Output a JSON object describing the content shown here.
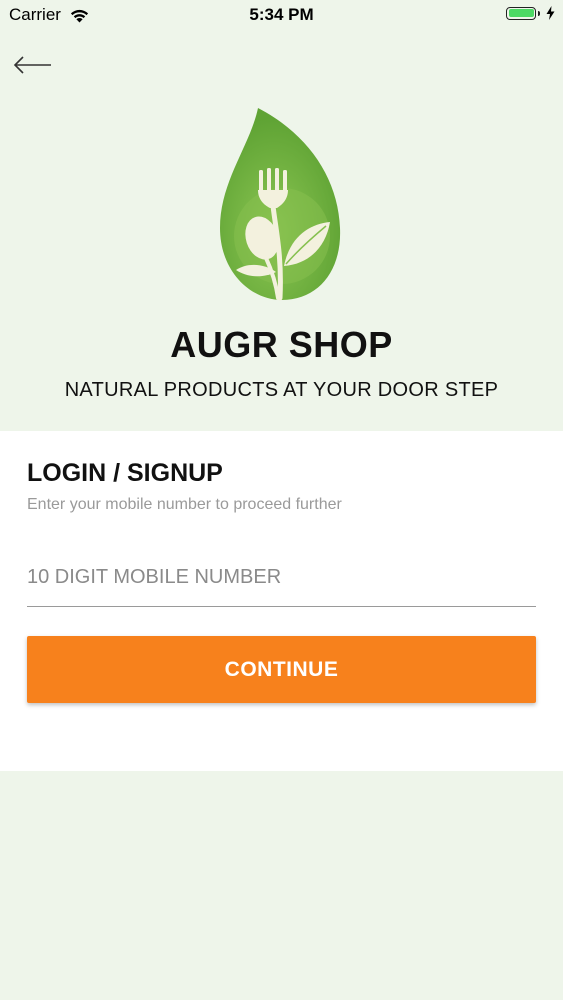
{
  "status_bar": {
    "carrier": "Carrier",
    "time": "5:34 PM",
    "battery_level": 1.0
  },
  "header": {
    "back_icon": "arrow-left-icon",
    "logo_icon": "leaf-fork-spoon-logo"
  },
  "brand": {
    "title": "AUGR SHOP",
    "tagline": "NATURAL PRODUCTS AT YOUR DOOR STEP"
  },
  "login": {
    "heading": "LOGIN / SIGNUP",
    "subtitle": "Enter your mobile number to proceed further",
    "mobile_placeholder": "10 DIGIT MOBILE NUMBER",
    "mobile_value": "",
    "continue_label": "CONTINUE"
  },
  "colors": {
    "background": "#eef5ea",
    "accent": "#f7811c",
    "logo_green": "#74b441"
  }
}
